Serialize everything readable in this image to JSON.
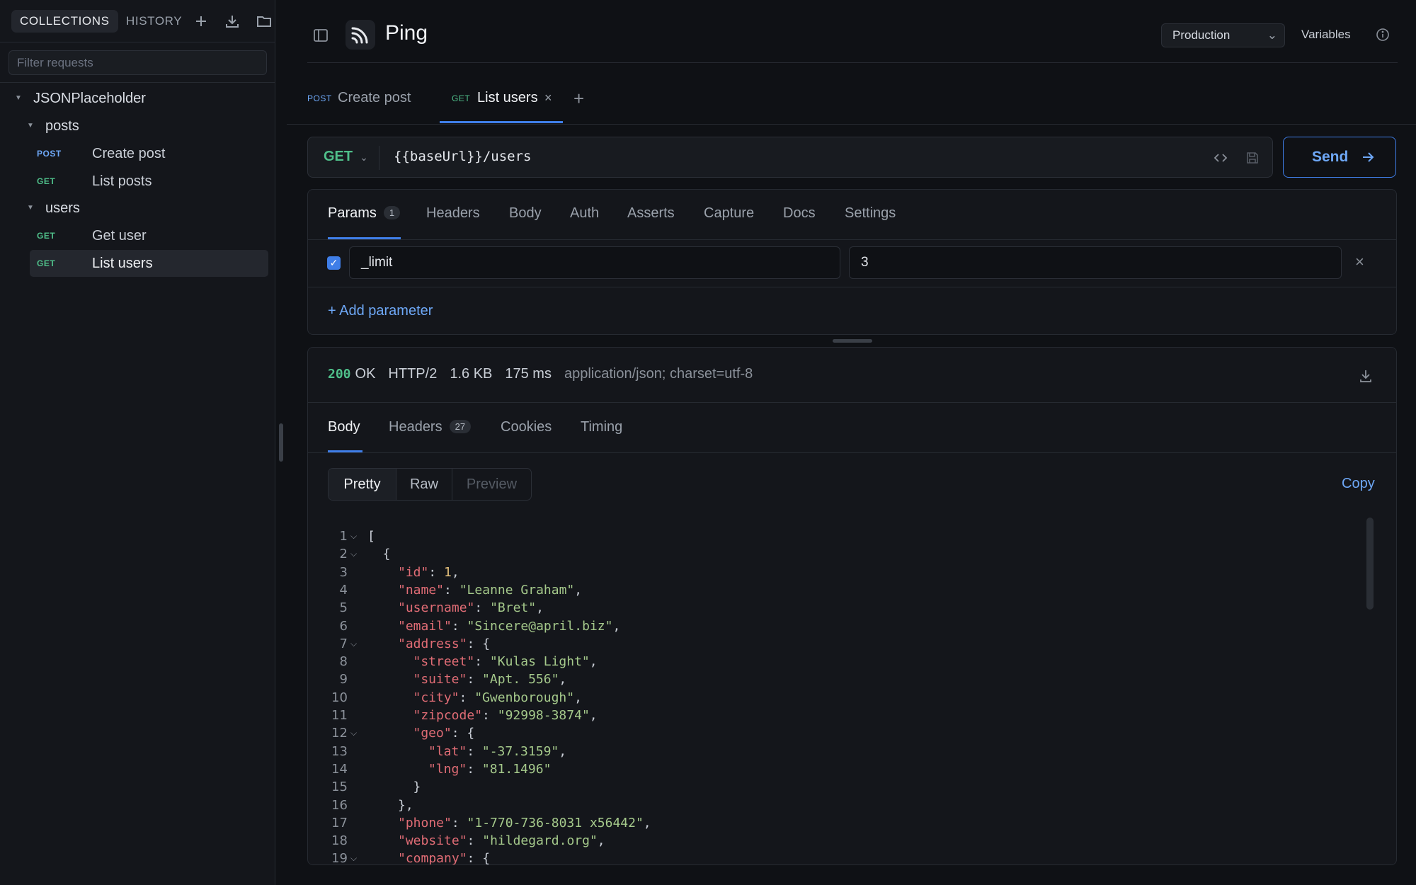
{
  "sidebar": {
    "tabs": [
      "COLLECTIONS",
      "HISTORY"
    ],
    "filter_placeholder": "Filter requests",
    "tree": {
      "collection": "JSONPlaceholder",
      "folders": [
        {
          "name": "posts",
          "items": [
            {
              "method": "POST",
              "label": "Create post"
            },
            {
              "method": "GET",
              "label": "List posts"
            }
          ]
        },
        {
          "name": "users",
          "items": [
            {
              "method": "GET",
              "label": "Get user"
            },
            {
              "method": "GET",
              "label": "List users"
            }
          ]
        }
      ]
    }
  },
  "header": {
    "title": "Ping",
    "environment": "Production",
    "variables_label": "Variables"
  },
  "request_tabs": [
    {
      "method": "POST",
      "label": "Create post"
    },
    {
      "method": "GET",
      "label": "List users"
    }
  ],
  "url_bar": {
    "method": "GET",
    "url": "{{baseUrl}}/users",
    "send_label": "Send"
  },
  "request_panel": {
    "tabs": [
      "Params",
      "Headers",
      "Body",
      "Auth",
      "Asserts",
      "Capture",
      "Docs",
      "Settings"
    ],
    "params_count": "1",
    "params": [
      {
        "key": "_limit",
        "value": "3",
        "enabled": true
      }
    ],
    "add_param_label": "+ Add parameter"
  },
  "response": {
    "status_code": "200",
    "status_text": "OK",
    "protocol": "HTTP/2",
    "size": "1.6 KB",
    "time": "175 ms",
    "content_type": "application/json; charset=utf-8",
    "tabs": [
      "Body",
      "Headers",
      "Cookies",
      "Timing"
    ],
    "headers_count": "27",
    "view_modes": [
      "Pretty",
      "Raw",
      "Preview"
    ],
    "copy_label": "Copy",
    "body_lines": [
      {
        "n": "1",
        "fold": true,
        "indent": 0,
        "parts": [
          [
            "p",
            "["
          ]
        ]
      },
      {
        "n": "2",
        "fold": true,
        "indent": 1,
        "parts": [
          [
            "p",
            "{"
          ]
        ]
      },
      {
        "n": "3",
        "fold": false,
        "indent": 2,
        "parts": [
          [
            "k",
            "\"id\""
          ],
          [
            "p",
            ": "
          ],
          [
            "n",
            "1"
          ],
          [
            "p",
            ","
          ]
        ]
      },
      {
        "n": "4",
        "fold": false,
        "indent": 2,
        "parts": [
          [
            "k",
            "\"name\""
          ],
          [
            "p",
            ": "
          ],
          [
            "s",
            "\"Leanne Graham\""
          ],
          [
            "p",
            ","
          ]
        ]
      },
      {
        "n": "5",
        "fold": false,
        "indent": 2,
        "parts": [
          [
            "k",
            "\"username\""
          ],
          [
            "p",
            ": "
          ],
          [
            "s",
            "\"Bret\""
          ],
          [
            "p",
            ","
          ]
        ]
      },
      {
        "n": "6",
        "fold": false,
        "indent": 2,
        "parts": [
          [
            "k",
            "\"email\""
          ],
          [
            "p",
            ": "
          ],
          [
            "s",
            "\"Sincere@april.biz\""
          ],
          [
            "p",
            ","
          ]
        ]
      },
      {
        "n": "7",
        "fold": true,
        "indent": 2,
        "parts": [
          [
            "k",
            "\"address\""
          ],
          [
            "p",
            ": {"
          ]
        ]
      },
      {
        "n": "8",
        "fold": false,
        "indent": 3,
        "parts": [
          [
            "k",
            "\"street\""
          ],
          [
            "p",
            ": "
          ],
          [
            "s",
            "\"Kulas Light\""
          ],
          [
            "p",
            ","
          ]
        ]
      },
      {
        "n": "9",
        "fold": false,
        "indent": 3,
        "parts": [
          [
            "k",
            "\"suite\""
          ],
          [
            "p",
            ": "
          ],
          [
            "s",
            "\"Apt. 556\""
          ],
          [
            "p",
            ","
          ]
        ]
      },
      {
        "n": "10",
        "fold": false,
        "indent": 3,
        "parts": [
          [
            "k",
            "\"city\""
          ],
          [
            "p",
            ": "
          ],
          [
            "s",
            "\"Gwenborough\""
          ],
          [
            "p",
            ","
          ]
        ]
      },
      {
        "n": "11",
        "fold": false,
        "indent": 3,
        "parts": [
          [
            "k",
            "\"zipcode\""
          ],
          [
            "p",
            ": "
          ],
          [
            "s",
            "\"92998-3874\""
          ],
          [
            "p",
            ","
          ]
        ]
      },
      {
        "n": "12",
        "fold": true,
        "indent": 3,
        "parts": [
          [
            "k",
            "\"geo\""
          ],
          [
            "p",
            ": {"
          ]
        ]
      },
      {
        "n": "13",
        "fold": false,
        "indent": 4,
        "parts": [
          [
            "k",
            "\"lat\""
          ],
          [
            "p",
            ": "
          ],
          [
            "s",
            "\"-37.3159\""
          ],
          [
            "p",
            ","
          ]
        ]
      },
      {
        "n": "14",
        "fold": false,
        "indent": 4,
        "parts": [
          [
            "k",
            "\"lng\""
          ],
          [
            "p",
            ": "
          ],
          [
            "s",
            "\"81.1496\""
          ]
        ]
      },
      {
        "n": "15",
        "fold": false,
        "indent": 3,
        "parts": [
          [
            "p",
            "}"
          ]
        ]
      },
      {
        "n": "16",
        "fold": false,
        "indent": 2,
        "parts": [
          [
            "p",
            "},"
          ]
        ]
      },
      {
        "n": "17",
        "fold": false,
        "indent": 2,
        "parts": [
          [
            "k",
            "\"phone\""
          ],
          [
            "p",
            ": "
          ],
          [
            "s",
            "\"1-770-736-8031 x56442\""
          ],
          [
            "p",
            ","
          ]
        ]
      },
      {
        "n": "18",
        "fold": false,
        "indent": 2,
        "parts": [
          [
            "k",
            "\"website\""
          ],
          [
            "p",
            ": "
          ],
          [
            "s",
            "\"hildegard.org\""
          ],
          [
            "p",
            ","
          ]
        ]
      },
      {
        "n": "19",
        "fold": true,
        "indent": 2,
        "parts": [
          [
            "k",
            "\"company\""
          ],
          [
            "p",
            ": {"
          ]
        ]
      }
    ]
  }
}
